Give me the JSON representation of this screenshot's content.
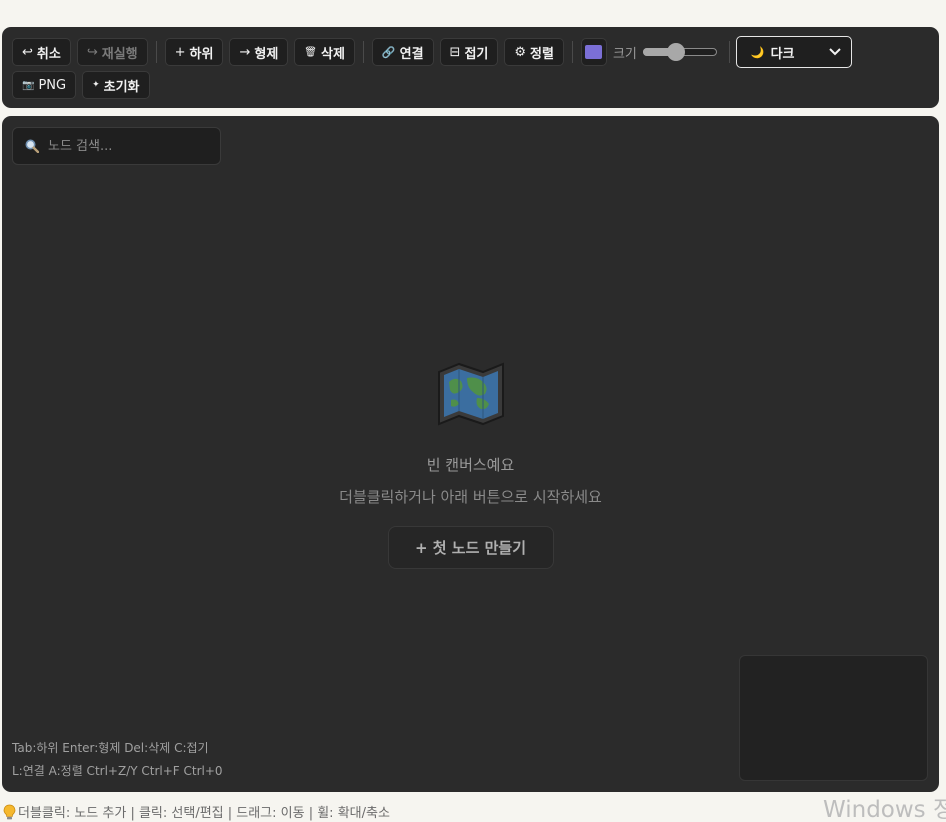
{
  "toolbar": {
    "undo": {
      "icon": "undo-icon",
      "glyph": "↩",
      "label": "취소"
    },
    "redo": {
      "icon": "redo-icon",
      "glyph": "↪",
      "label": "재실행"
    },
    "add_child": {
      "icon": "plus-icon",
      "glyph": "+",
      "label": "하위"
    },
    "add_sibling": {
      "icon": "arrow-right-icon",
      "glyph": "→",
      "label": "형제"
    },
    "delete": {
      "icon": "trash-icon",
      "glyph": "🗑",
      "label": "삭제"
    },
    "connect": {
      "icon": "link-icon",
      "glyph": "🔗",
      "label": "연결"
    },
    "collapse": {
      "icon": "collapse-icon",
      "glyph": "⊟",
      "label": "접기"
    },
    "arrange": {
      "icon": "gear-icon",
      "glyph": "⚙",
      "label": "정렬"
    },
    "node_color": "#7b6fd6",
    "size_label": "크기",
    "size_value": 0.45,
    "theme": {
      "icon": "moon-icon",
      "glyph": "🌙",
      "label": "다크"
    },
    "export_png": {
      "icon": "camera-icon",
      "glyph": "📷",
      "label": "PNG"
    },
    "reset": {
      "icon": "sparkle-icon",
      "glyph": "✦",
      "label": "초기화"
    }
  },
  "search": {
    "placeholder": "노드 검색..."
  },
  "empty_state": {
    "icon": "map-icon",
    "title": "빈 캔버스예요",
    "subtitle": "더블클릭하거나 아래 버튼으로 시작하세요",
    "button": "+ 첫 노드 만들기"
  },
  "shortcuts": {
    "line1": "Tab:하위 Enter:형제 Del:삭제 C:접기",
    "line2": "L:연결 A:정렬 Ctrl+Z/Y Ctrl+F Ctrl+0"
  },
  "status_bar": {
    "icon": "lightbulb-icon",
    "text": "더블클릭: 노드 추가 | 클릭: 선택/편집 | 드래그: 이동 | 휠: 확대/축소"
  },
  "watermark": "Windows 정"
}
